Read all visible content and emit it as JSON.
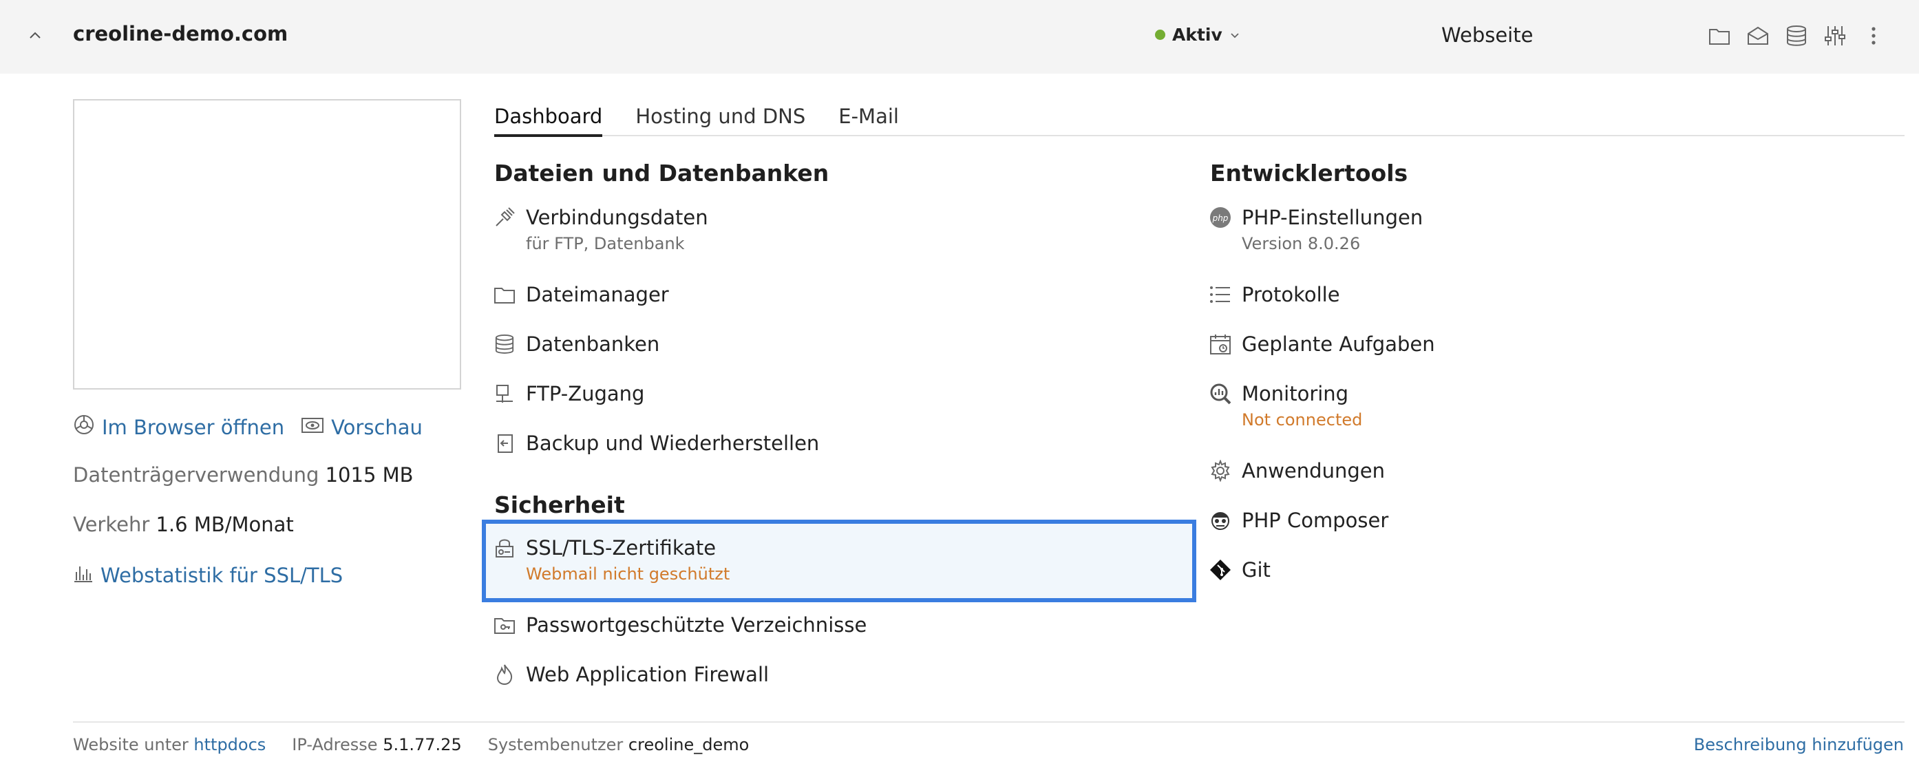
{
  "header": {
    "domain": "creoline-demo.com",
    "status_label": "Aktiv",
    "status_color": "#74ad32",
    "site_type": "Webseite",
    "icons": [
      "folder-icon",
      "mail-icon",
      "database-icon",
      "sliders-icon",
      "more-vertical-icon"
    ]
  },
  "left": {
    "open_browser": "Im Browser öffnen",
    "preview": "Vorschau",
    "disk_label": "Datenträgerverwendung",
    "disk_value": "1015 MB",
    "traffic_label": "Verkehr",
    "traffic_value": "1.6 MB/Monat",
    "webstat": "Webstatistik für SSL/TLS"
  },
  "tabs": [
    "Dashboard",
    "Hosting und DNS",
    "E-Mail"
  ],
  "files": {
    "title": "Dateien und Datenbanken",
    "items": [
      {
        "label": "Verbindungsdaten",
        "sub": "für FTP, Datenbank"
      },
      {
        "label": "Dateimanager"
      },
      {
        "label": "Datenbanken"
      },
      {
        "label": "FTP-Zugang"
      },
      {
        "label": "Backup und Wiederherstellen"
      }
    ]
  },
  "security": {
    "title": "Sicherheit",
    "items": [
      {
        "label": "SSL/TLS-Zertifikate",
        "sub": "Webmail nicht geschützt"
      },
      {
        "label": "Passwortgeschützte Verzeichnisse"
      },
      {
        "label": "Web Application Firewall"
      }
    ]
  },
  "dev": {
    "title": "Entwicklertools",
    "items": [
      {
        "label": "PHP-Einstellungen",
        "sub": "Version 8.0.26"
      },
      {
        "label": "Protokolle"
      },
      {
        "label": "Geplante Aufgaben"
      },
      {
        "label": "Monitoring",
        "sub": "Not connected"
      },
      {
        "label": "Anwendungen"
      },
      {
        "label": "PHP Composer"
      },
      {
        "label": "Git"
      }
    ]
  },
  "footer": {
    "website_label": "Website unter",
    "website_value": "httpdocs",
    "ip_label": "IP-Adresse",
    "ip_value": "5.1.77.25",
    "user_label": "Systembenutzer",
    "user_value": "creoline_demo",
    "add_description": "Beschreibung hinzufügen"
  },
  "colors": {
    "link": "#2e6da4",
    "warning": "#d17a2b",
    "highlight_border": "#3a7de0",
    "highlight_bg": "#f1f7fc"
  }
}
